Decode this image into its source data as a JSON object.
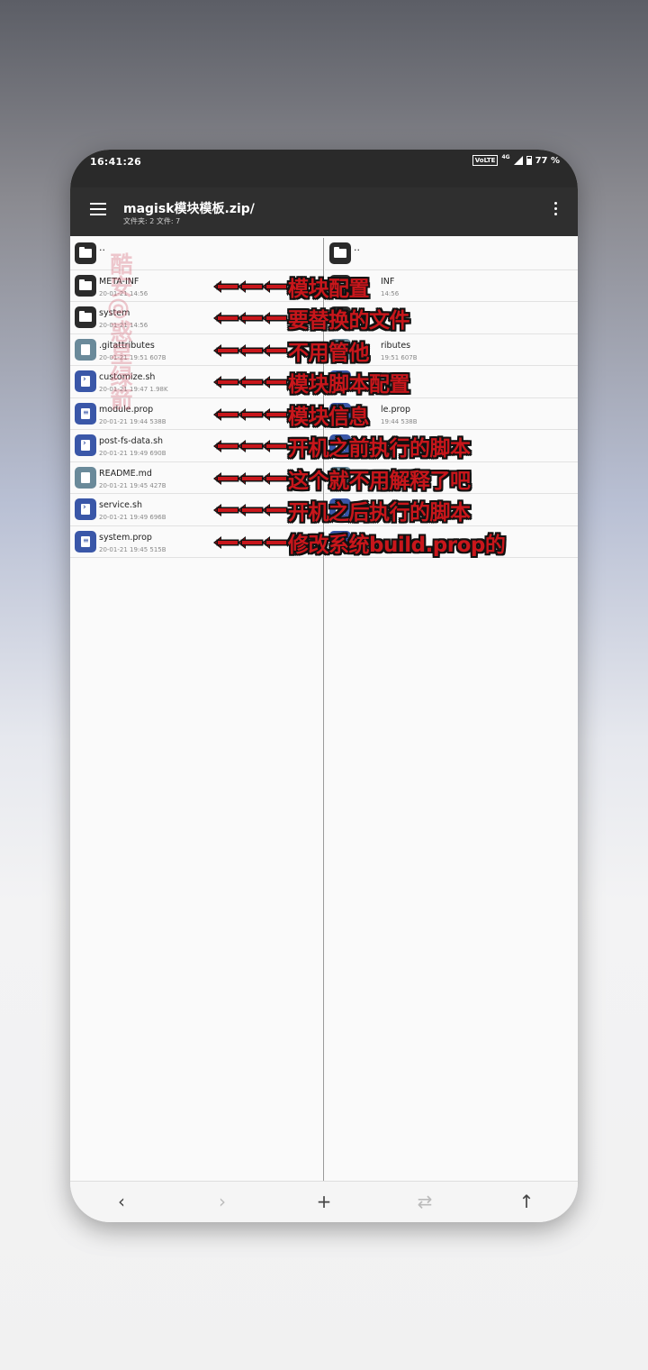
{
  "status_bar": {
    "time": "16:41:26",
    "volte": "VoLTE",
    "network": "4G",
    "battery": "77 %"
  },
  "app_bar": {
    "title": "magisk模块模板.zip/",
    "subtitle": "文件夹: 2  文件: 7"
  },
  "left_pane": {
    "rows": [
      {
        "name": "..",
        "meta": "",
        "type": "folder"
      },
      {
        "name": "META-INF",
        "meta": "20-01-21 14:56",
        "type": "folder"
      },
      {
        "name": "system",
        "meta": "20-01-21 14:56",
        "type": "folder"
      },
      {
        "name": ".gitattributes",
        "meta": "20-01-21 19:51  607B",
        "type": "plain"
      },
      {
        "name": "customize.sh",
        "meta": "20-01-21 19:47  1.98K",
        "type": "script"
      },
      {
        "name": "module.prop",
        "meta": "20-01-21 19:44  538B",
        "type": "text"
      },
      {
        "name": "post-fs-data.sh",
        "meta": "20-01-21 19:49  690B",
        "type": "script"
      },
      {
        "name": "README.md",
        "meta": "20-01-21 19:45  427B",
        "type": "plain"
      },
      {
        "name": "service.sh",
        "meta": "20-01-21 19:49  696B",
        "type": "script"
      },
      {
        "name": "system.prop",
        "meta": "20-01-21 19:45  515B",
        "type": "text"
      }
    ]
  },
  "right_pane": {
    "rows": [
      {
        "name": "..",
        "meta": ""
      },
      {
        "name": "INF",
        "meta": "14:56"
      },
      {
        "name": "",
        "meta": ""
      },
      {
        "name": "ributes",
        "meta": "19:51  607B"
      },
      {
        "name": "",
        "meta": ""
      },
      {
        "name": "le.prop",
        "meta": "19:44  538B"
      },
      {
        "name": "",
        "meta": ""
      },
      {
        "name": "",
        "meta": ""
      },
      {
        "name": "",
        "meta": ""
      },
      {
        "name": "",
        "meta": ""
      }
    ]
  },
  "annotations": [
    "模块配置",
    "要替换的文件",
    "不用管他",
    "模块脚本配置",
    "模块信息",
    "开机之前执行的脚本",
    "这个就不用解释了吧",
    "开机之后执行的脚本",
    "修改系统build.prop的"
  ],
  "watermark": "酷安@惑星绿箭",
  "bottom_bar": {
    "back": "‹",
    "forward": "›",
    "add": "+",
    "swap": "⇄",
    "up": "↑"
  },
  "colors": {
    "annotation_red": "#c8161b",
    "app_bar": "#2f2f2f",
    "script_icon": "#3a57a8",
    "plain_icon": "#6a8a9a"
  }
}
